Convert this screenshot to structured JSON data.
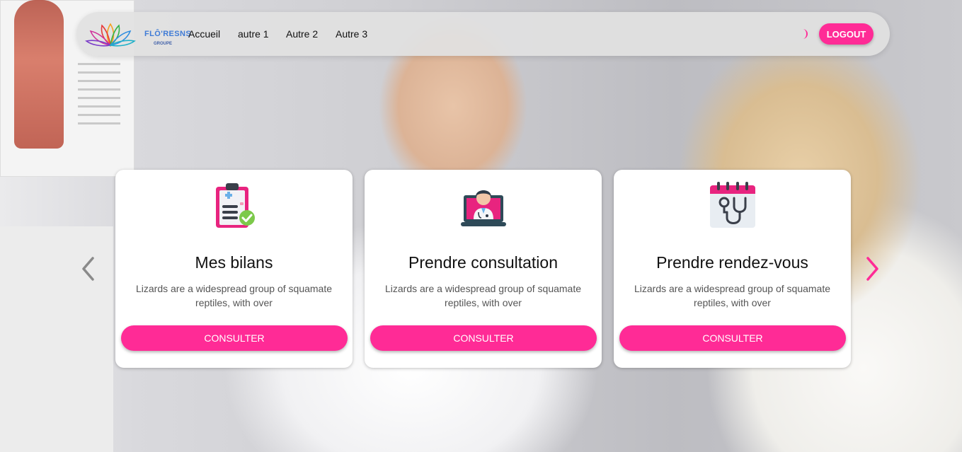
{
  "brand": {
    "name": "FLÔ'RESNS",
    "subtitle": "GROUPE"
  },
  "nav": {
    "links": [
      "Accueil",
      "autre 1",
      "Autre 2",
      "Autre 3"
    ],
    "logout_label": "LOGOUT",
    "theme_icon": "moon-icon"
  },
  "carousel": {
    "prev_icon": "chevron-left-icon",
    "next_icon": "chevron-right-icon",
    "cards": [
      {
        "icon": "clipboard-report-icon",
        "title": "Mes bilans",
        "description": "Lizards are a widespread group of squamate reptiles, with over",
        "button": "CONSULTER"
      },
      {
        "icon": "doctor-laptop-icon",
        "title": "Prendre consultation",
        "description": "Lizards are a widespread group of squamate reptiles, with over",
        "button": "CONSULTER"
      },
      {
        "icon": "calendar-stethoscope-icon",
        "title": "Prendre rendez-vous",
        "description": "Lizards are a widespread group of squamate reptiles, with over",
        "button": "CONSULTER"
      }
    ]
  },
  "colors": {
    "accent": "#ff2b96",
    "navbar_bg": "#e1e1e1",
    "card_bg": "#ffffff",
    "arrow_inactive": "#8a8a8a"
  }
}
